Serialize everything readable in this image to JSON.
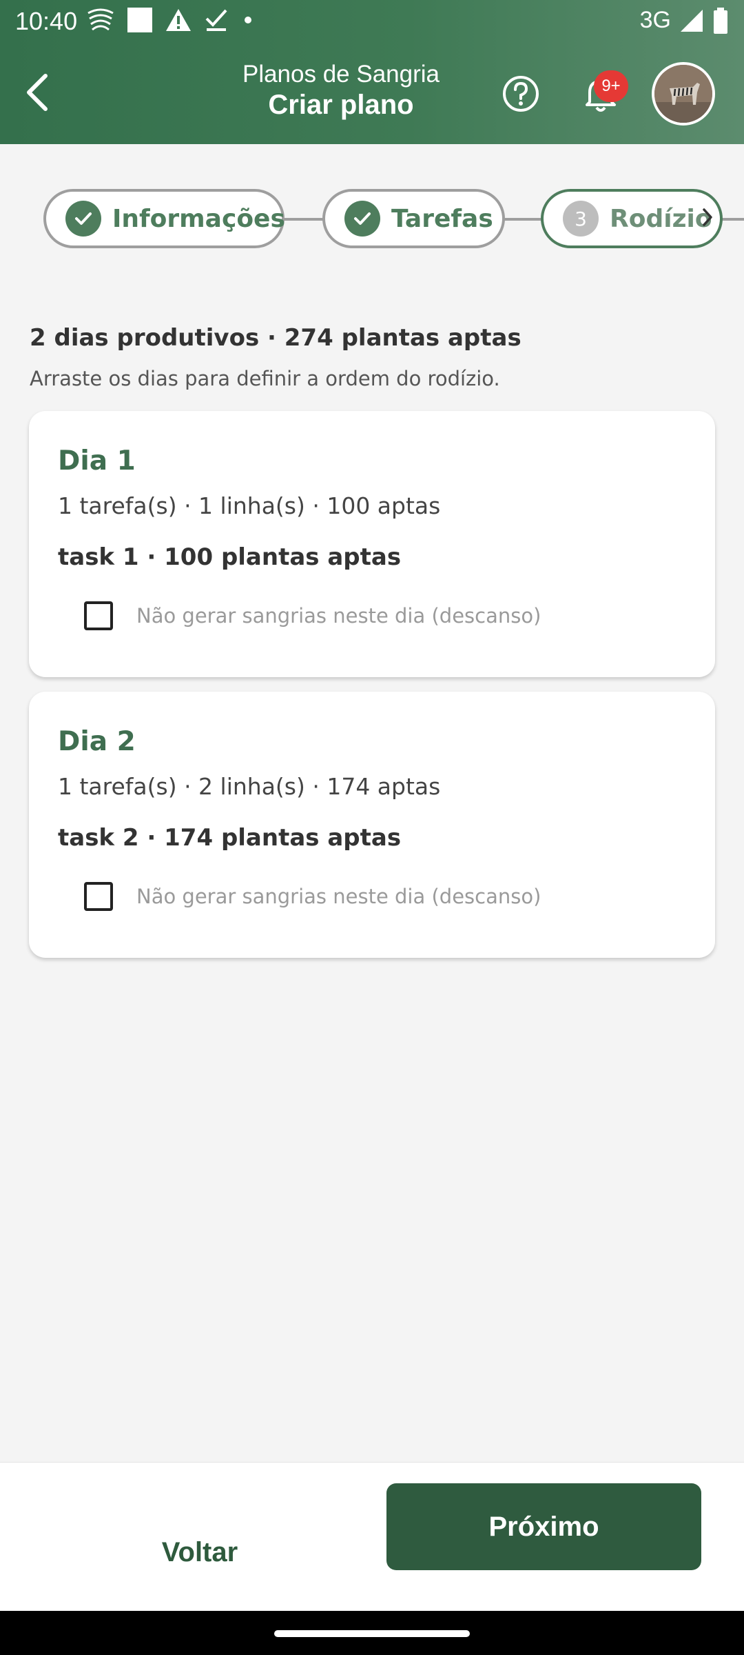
{
  "status_bar": {
    "time": "10:40",
    "network": "3G",
    "left_icons": [
      "wifi-waves-icon",
      "square-icon",
      "warning-icon",
      "download-check-icon",
      "dot-icon"
    ],
    "right_icons": [
      "signal-icon",
      "battery-icon"
    ]
  },
  "app_bar": {
    "subtitle": "Planos de Sangria",
    "title": "Criar plano",
    "notification_badge": "9+",
    "accent_color": "#34704c"
  },
  "stepper": {
    "steps": [
      {
        "label": "Informações",
        "state": "done"
      },
      {
        "label": "Tarefas",
        "state": "done"
      },
      {
        "number": "3",
        "label": "Rodízio",
        "state": "active"
      }
    ]
  },
  "main": {
    "summary": "2 dias produtivos · 274 plantas aptas",
    "hint": "Arraste os dias para definir a ordem do rodízio.",
    "days": [
      {
        "title": "Dia 1",
        "meta": "1 tarefa(s) · 1 linha(s) · 100 aptas",
        "task": "task 1 · 100 plantas aptas",
        "rest_label": "Não gerar sangrias neste dia (descanso)",
        "rest_checked": false
      },
      {
        "title": "Dia 2",
        "meta": "1 tarefa(s) · 2 linha(s) · 174 aptas",
        "task": "task 2 · 174 plantas aptas",
        "rest_label": "Não gerar sangrias neste dia (descanso)",
        "rest_checked": false
      }
    ]
  },
  "footer": {
    "back_label": "Voltar",
    "next_label": "Próximo",
    "primary_color": "#2f5b3f"
  }
}
